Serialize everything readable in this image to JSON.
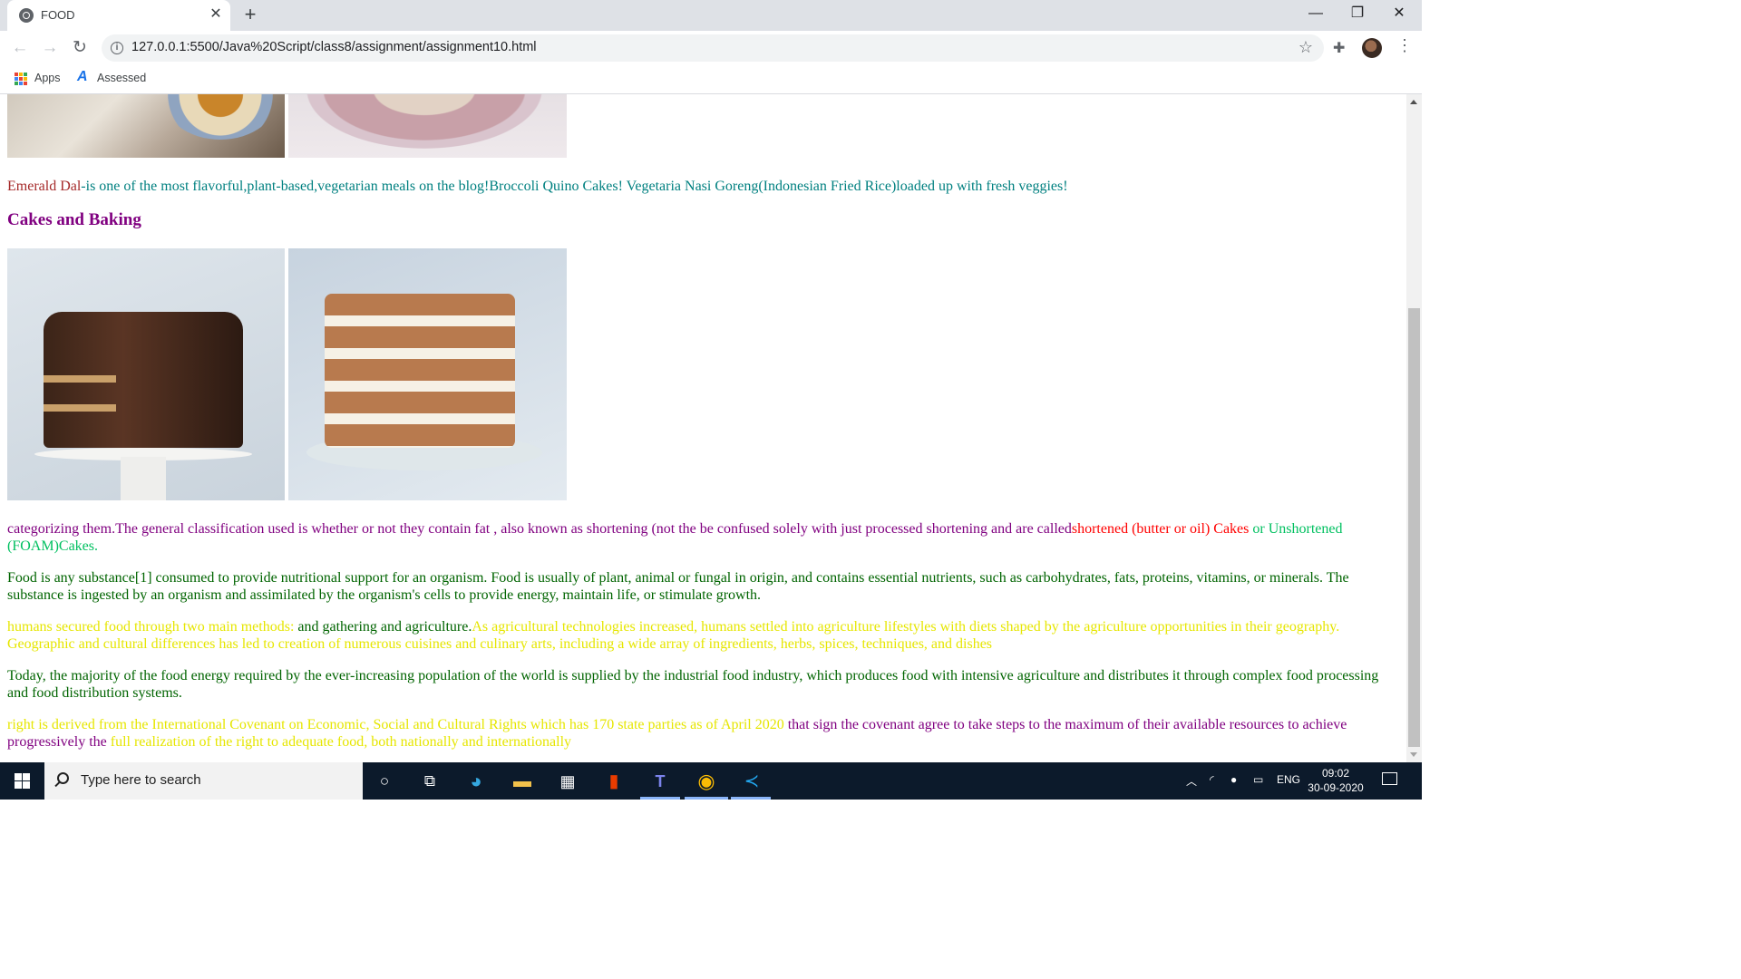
{
  "browser": {
    "tab_title": "FOOD",
    "tab_close": "✕",
    "new_tab": "+",
    "minimize": "—",
    "restore": "❐",
    "close": "✕",
    "url": "127.0.0.1:5500/Java%20Script/class8/assignment/assignment10.html",
    "bookmarks": {
      "apps_label": "Apps",
      "assessed_label": "Assessed"
    }
  },
  "page": {
    "veg_intro": {
      "emerald": "Emerald Dal",
      "rest": "-is one of the most flavorful,plant-based,vegetarian meals on the blog!Broccoli Quino Cakes! Vegetaria Nasi Goreng(Indonesian Fried Rice)loaded up with fresh veggies!"
    },
    "cakes_heading": "Cakes and Baking",
    "cakes_para": {
      "main": "categorizing them.The general classification used is whether or not they contain fat , also known as shortening (not the be confused solely with just processed shortening and are called",
      "shortened": "shortened (butter or oil) Cakes",
      "unshortened": " or Unshortened (FOAM)Cakes."
    },
    "food_para": "Food is any substance[1] consumed to provide nutritional support for an organism. Food is usually of plant, animal or fungal in origin, and contains essential nutrients, such as carbohydrates, fats, proteins, vitamins, or minerals. The substance is ingested by an organism and assimilated by the organism's cells to provide energy, maintain life, or stimulate growth.",
    "humans_para": {
      "part1": "humans secured food through two main methods: ",
      "part2": "and gathering and agriculture.",
      "part3": "As agricultural technologies increased, humans settled into agriculture lifestyles with diets shaped by the agriculture opportunities in their geography. Geographic and cultural differences has led to creation of numerous cuisines and culinary arts, including a wide array of ingredients, herbs, spices, techniques, and dishes"
    },
    "today_para": "Today, the majority of the food energy required by the ever-increasing population of the world is supplied by the industrial food industry, which produces food with intensive agriculture and distributes it through complex food processing and food distribution systems.",
    "right_para": {
      "part1": "right is derived from the International Covenant on Economic, Social and Cultural Rights which has 170 state parties as of April 2020 ",
      "part2": "that sign the covenant agree to take steps to the maximum of their available resources to achieve progressively the ",
      "part3": "full realization of the right to adequate food, both nationally and internationally"
    }
  },
  "taskbar": {
    "search_placeholder": "Type here to search",
    "language": "ENG",
    "time": "09:02",
    "date": "30-09-2020"
  },
  "icons": [
    "globe-icon",
    "info-icon",
    "star-icon",
    "extensions-icon",
    "apps-icon",
    "windows-icon",
    "cortana-icon",
    "task-view-icon",
    "edge-icon",
    "file-explorer-icon",
    "store-icon",
    "office-icon",
    "teams-icon",
    "chrome-icon",
    "vscode-icon"
  ],
  "colors": {
    "teal_text": "#008080",
    "brown_text": "#a52a2a",
    "purple_text": "#800080",
    "red_text": "#ff0000",
    "spring_green_text": "#00c060",
    "green_text": "#006400",
    "yellow_text": "#e6e600",
    "taskbar_bg": "#0c1a2b"
  }
}
